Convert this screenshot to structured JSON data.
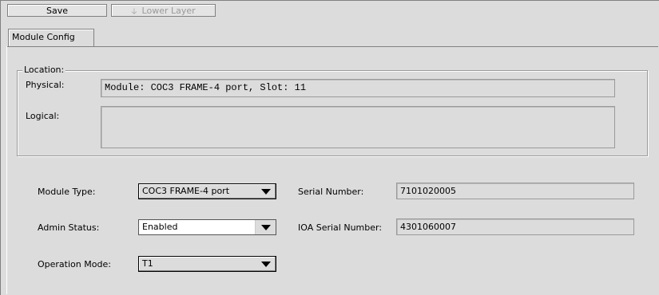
{
  "toolbar": {
    "save_label": "Save",
    "lower_layer_label": "Lower Layer",
    "lower_layer_icon": "down-arrow-icon"
  },
  "tabs": [
    {
      "label": "Module Config",
      "selected": true
    }
  ],
  "location": {
    "legend": "Location:",
    "physical_label": "Physical:",
    "physical_value": "Module: COC3 FRAME-4 port, Slot: 11",
    "logical_label": "Logical:",
    "logical_value": ""
  },
  "form": {
    "module_type": {
      "label": "Module Type:",
      "value": "COC3 FRAME-4 port"
    },
    "admin_status": {
      "label": "Admin Status:",
      "value": "Enabled"
    },
    "operation_mode": {
      "label": "Operation Mode:",
      "value": "T1"
    },
    "serial_number": {
      "label": "Serial Number:",
      "value": "7101020005"
    },
    "ioa_serial_number": {
      "label": "IOA Serial Number:",
      "value": "4301060007"
    }
  }
}
